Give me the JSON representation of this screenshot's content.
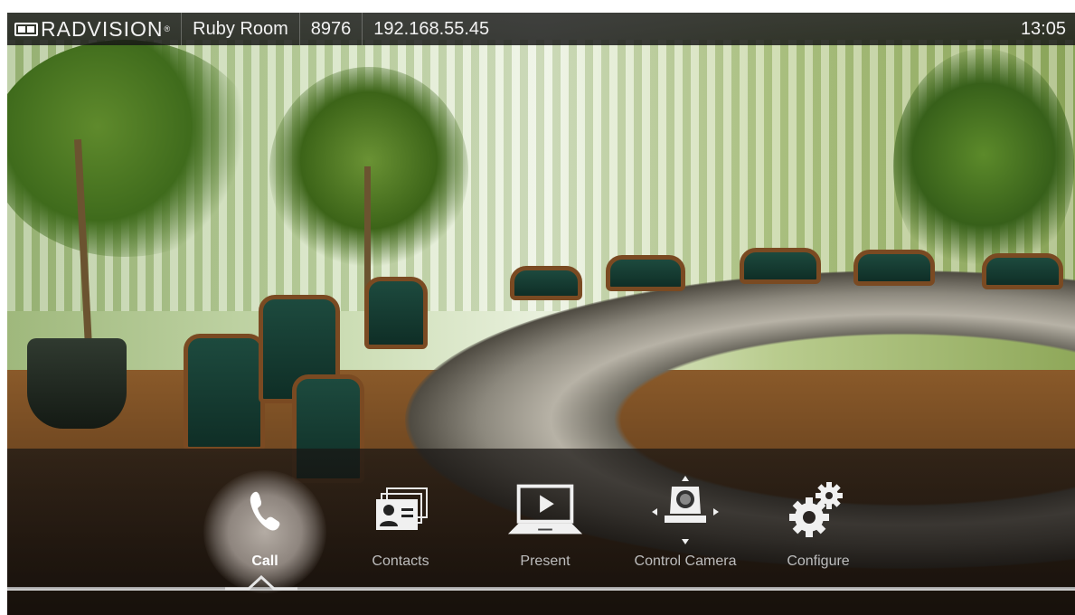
{
  "header": {
    "brand": "RADVISION",
    "brand_mark": "®",
    "room_name": "Ruby Room",
    "extension": "8976",
    "ip_address": "192.168.55.45",
    "time": "13:05"
  },
  "menu": {
    "items": [
      {
        "label": "Call",
        "icon": "phone-icon",
        "active": true
      },
      {
        "label": "Contacts",
        "icon": "contacts-icon",
        "active": false
      },
      {
        "label": "Present",
        "icon": "present-laptop-icon",
        "active": false
      },
      {
        "label": "Control Camera",
        "icon": "camera-control-icon",
        "active": false
      },
      {
        "label": "Configure",
        "icon": "gears-icon",
        "active": false
      }
    ]
  },
  "colors": {
    "text": "#ffffff",
    "inactive_label": "#bdbdbd",
    "bar": "#1e1e1e"
  }
}
